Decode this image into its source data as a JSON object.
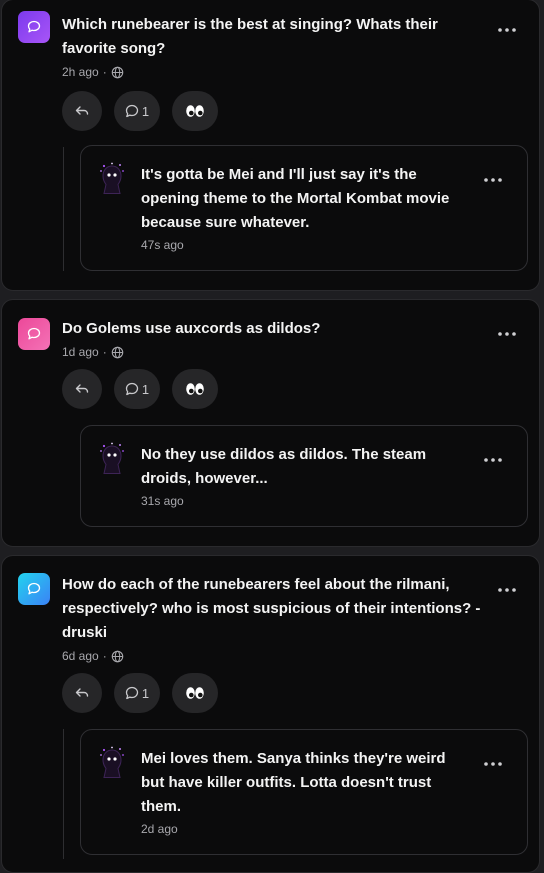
{
  "posts": [
    {
      "question": "Which runebearer is the best at singing? Whats their favorite song?",
      "time": "2h ago",
      "comment_count": "1",
      "icon_gradient": [
        "#7c3aed",
        "#a855f7"
      ],
      "reply": {
        "text": "It's gotta be Mei and I'll just say it's the opening theme to the Mortal Kombat movie because sure whatever.",
        "time": "47s ago"
      }
    },
    {
      "question": "Do Golems use auxcords as dildos?",
      "time": "1d ago",
      "comment_count": "1",
      "icon_gradient": [
        "#ec4899",
        "#f472b6"
      ],
      "reply": {
        "text": "No they use dildos as dildos. The steam droids, however...",
        "time": "31s ago"
      }
    },
    {
      "question": "How do each of the runebearers feel about the rilmani, respectively? who is most suspicious of their intentions? - druski",
      "time": "6d ago",
      "comment_count": "1",
      "icon_gradient": [
        "#22d3ee",
        "#3b82f6"
      ],
      "reply": {
        "text": "Mei loves them. Sanya thinks they're weird but have killer outfits. Lotta doesn't trust them.",
        "time": "2d ago"
      }
    }
  ],
  "icons": {
    "question_icon": "speech-bubble-icon",
    "visibility_icon": "globe-icon",
    "reply_action_icon": "reply-arrow-icon",
    "comment_action_icon": "comment-bubble-icon",
    "eyes_action_icon": "eyes-icon",
    "menu_icon": "more-dots-icon",
    "avatar": "purple-creature-avatar"
  },
  "colors": {
    "background": "#1e1e21",
    "card": "#0b0b0c",
    "pill": "#262628",
    "avatar": "#1a0f24"
  }
}
